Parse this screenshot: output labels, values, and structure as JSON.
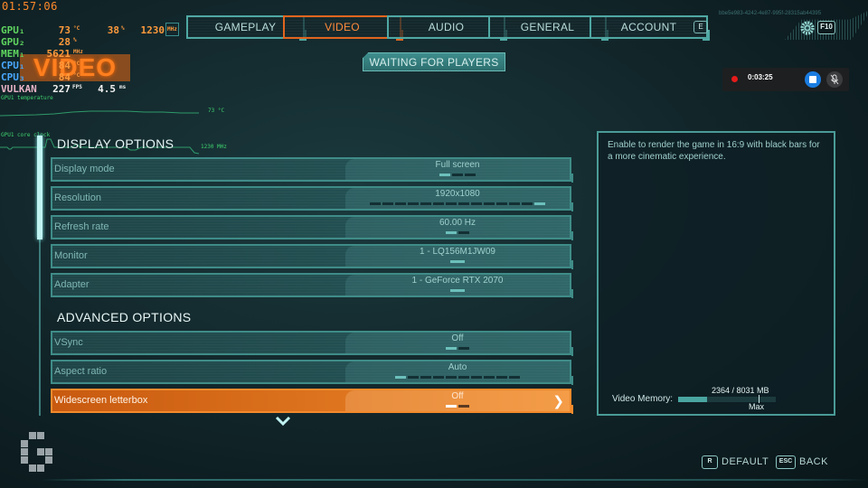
{
  "hud": {
    "clock": "01:57:06",
    "rows": [
      {
        "label": "GPU₁",
        "values": [
          {
            "v": "73",
            "u": "°C"
          },
          {
            "v": "38",
            "u": "%"
          },
          {
            "v": "1230",
            "u": "MHz"
          }
        ]
      },
      {
        "label": "GPU₂",
        "values": [
          {
            "v": "28",
            "u": "%"
          }
        ]
      },
      {
        "label": "MEM₁",
        "values": [
          {
            "v": "5621",
            "u": "MHz"
          }
        ]
      },
      {
        "label": "CPU₁",
        "values": [
          {
            "v": "84",
            "u": "°C"
          }
        ]
      },
      {
        "label": "CPU₃",
        "values": [
          {
            "v": "84",
            "u": "°C"
          }
        ]
      },
      {
        "label": "VULKAN",
        "values": [
          {
            "v": "227",
            "u": "FPS"
          },
          {
            "v": "4.5",
            "u": "ms"
          }
        ]
      }
    ],
    "graph1_label": "GPU1 temperature",
    "graph1_value": "73 °C",
    "graph2_label": "GPU1 core clock",
    "graph2_value": "1230 MHz",
    "watermark": "VIDEO"
  },
  "tabs": [
    {
      "label": "GAMEPLAY",
      "active": false
    },
    {
      "label": "VIDEO",
      "active": true
    },
    {
      "label": "AUDIO",
      "active": false
    },
    {
      "label": "GENERAL",
      "active": false
    },
    {
      "label": "ACCOUNT",
      "active": false
    }
  ],
  "tab_next_key": "E",
  "session_id": "bbe5e983-4242-4e87-995f-28315ab44395",
  "settings_key": "F10",
  "status_badge": "WAITING FOR PLAYERS",
  "recording": {
    "time": "0:03:25"
  },
  "sections": [
    {
      "title": "DISPLAY OPTIONS",
      "options": [
        {
          "label": "Display mode",
          "value": "Full screen",
          "segments": 3,
          "selected_index": 0
        },
        {
          "label": "Resolution",
          "value": "1920x1080",
          "segments": 14,
          "selected_index": 13
        },
        {
          "label": "Refresh rate",
          "value": "60.00 Hz",
          "segments": 2,
          "selected_index": 0
        },
        {
          "label": "Monitor",
          "value": "1 - LQ156M1JW09",
          "segments": 1,
          "selected_index": 0
        },
        {
          "label": "Adapter",
          "value": "1 - GeForce RTX 2070",
          "segments": 1,
          "selected_index": 0
        }
      ]
    },
    {
      "title": "ADVANCED OPTIONS",
      "options": [
        {
          "label": "VSync",
          "value": "Off",
          "segments": 2,
          "selected_index": 0
        },
        {
          "label": "Aspect ratio",
          "value": "Auto",
          "segments": 10,
          "selected_index": 0
        },
        {
          "label": "Widescreen letterbox",
          "value": "Off",
          "segments": 2,
          "selected_index": 0,
          "highlighted": true
        }
      ]
    }
  ],
  "description": {
    "text": "Enable to render the game in 16:9 with black bars for a more cinematic experience.",
    "video_memory_label": "Video Memory:",
    "video_memory_value": "2364 / 8031 MB",
    "video_memory_used_mb": 2364,
    "video_memory_total_mb": 8031,
    "video_memory_max_label": "Max"
  },
  "footer": {
    "default_key": "R",
    "default_label": "DEFAULT",
    "back_key": "ESC",
    "back_label": "BACK"
  },
  "colors": {
    "accent_orange": "#e0651e",
    "accent_teal": "#4fa8a3",
    "highlight_row": "#f08a2a"
  }
}
